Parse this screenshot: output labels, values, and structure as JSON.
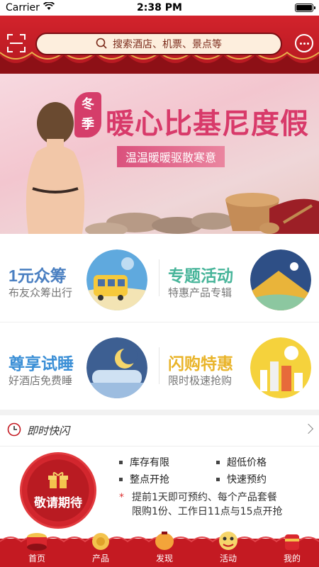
{
  "status_bar": {
    "carrier": "Carrier",
    "time": "2:38 PM"
  },
  "header": {
    "search_placeholder": "搜索酒店、机票、景点等"
  },
  "banner": {
    "season_1": "冬",
    "season_2": "季",
    "title": "暖心比基尼度假",
    "subtitle": "温温暖暖驱散寒意"
  },
  "tiles": [
    {
      "title": "1元众筹",
      "subtitle": "布友众筹出行",
      "color": "#4a7fc1"
    },
    {
      "title": "专题活动",
      "subtitle": "特惠产品专辑",
      "color": "#48b59a"
    },
    {
      "title": "尊享试睡",
      "subtitle": "好酒店免费睡",
      "color": "#3b8fd6"
    },
    {
      "title": "闪购特惠",
      "subtitle": "限时极速抢购",
      "color": "#e9b42a"
    }
  ],
  "flash": {
    "title": "即时快闪",
    "badge_text": "敬请期待",
    "features": [
      "库存有限",
      "超低价格",
      "整点开抢",
      "快速预约"
    ],
    "note": "提前1天即可预约、每个产品套餐限购1份、工作日11点与15点开抢"
  },
  "tabbar": {
    "items": [
      "首页",
      "产品",
      "发现",
      "活动",
      "我的"
    ]
  },
  "colors": {
    "brand_red": "#c41a22",
    "search_bg": "#fdeedd"
  }
}
